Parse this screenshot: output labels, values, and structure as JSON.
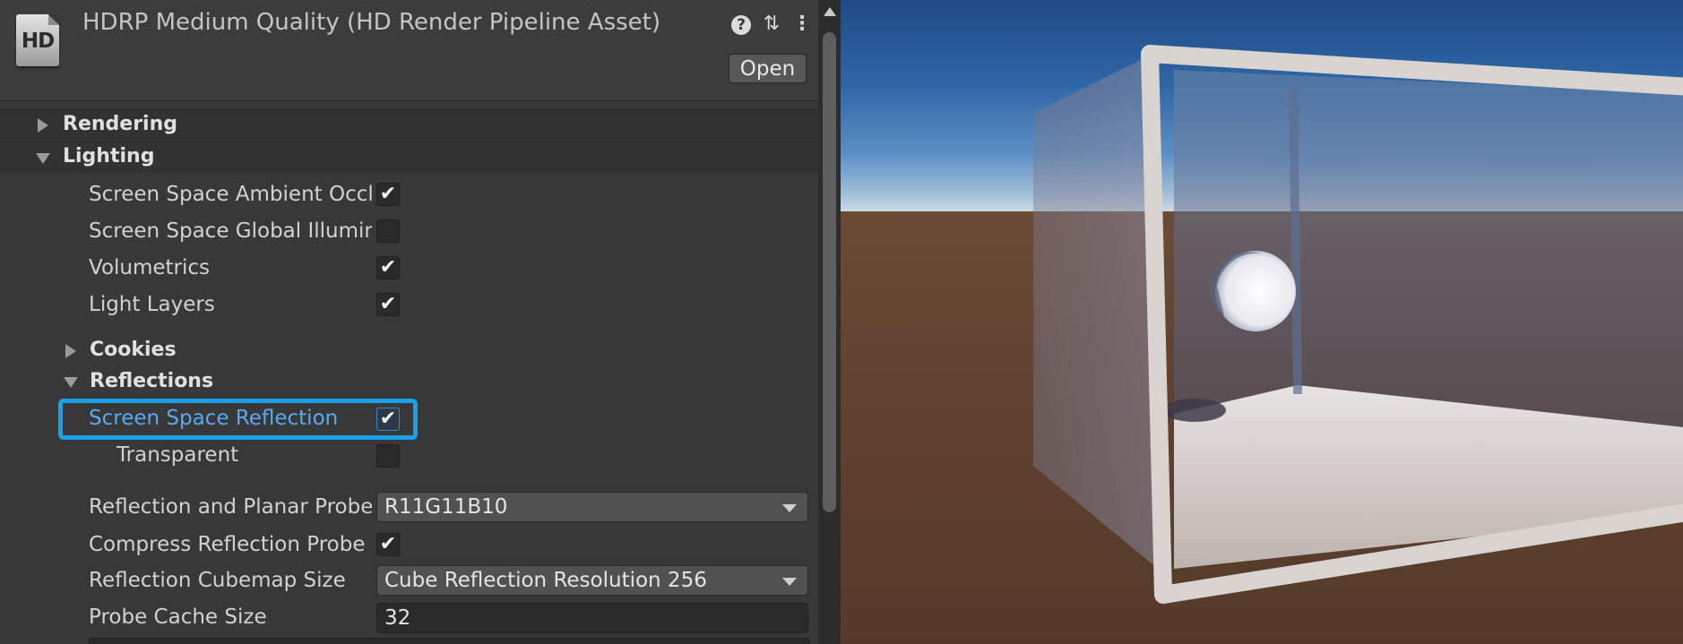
{
  "inspector": {
    "header": {
      "icon_text": "HD",
      "title": "HDRP Medium Quality (HD Render Pipeline Asset)",
      "help_icon_glyph": "?",
      "presets_icon_glyph": "⇅",
      "menu_icon_glyph": "⋮",
      "open_button_label": "Open"
    },
    "sections": {
      "rendering": {
        "label": "Rendering",
        "expanded": false
      },
      "lighting": {
        "label": "Lighting",
        "expanded": true
      }
    },
    "lighting_props": [
      {
        "label": "Screen Space Ambient Occl",
        "checked": true,
        "check_glyph": "✔"
      },
      {
        "label": "Screen Space Global Illumin",
        "checked": false,
        "check_glyph": ""
      },
      {
        "label": "Volumetrics",
        "checked": true,
        "check_glyph": "✔"
      },
      {
        "label": "Light Layers",
        "checked": true,
        "check_glyph": "✔"
      }
    ],
    "subsections": {
      "cookies": {
        "label": "Cookies",
        "expanded": false
      },
      "reflections": {
        "label": "Reflections",
        "expanded": true
      }
    },
    "reflection_props": {
      "ssr": {
        "label": "Screen Space Reflection",
        "checked": true,
        "check_glyph": "✔",
        "highlight_color": "#1aa0e8"
      },
      "transparent": {
        "label": "Transparent",
        "checked": false,
        "check_glyph": ""
      },
      "probe_format": {
        "label": "Reflection and Planar Probe",
        "value": "R11G11B10"
      },
      "compress": {
        "label": "Compress Reflection Probe",
        "checked": true,
        "check_glyph": "✔"
      },
      "cubemap_size": {
        "label": "Reflection Cubemap Size",
        "value": "Cube Reflection Resolution 256"
      },
      "probe_cache": {
        "label": "Probe Cache Size",
        "value": "32"
      }
    }
  },
  "scene": {
    "sky_color": "#2f67a6",
    "ground_color": "#604230",
    "cube_frame_color": "#d9d4cf"
  },
  "colors": {
    "panel_bg": "#383838",
    "accent": "#1aa0e8",
    "label_link": "#5aa8f0"
  }
}
